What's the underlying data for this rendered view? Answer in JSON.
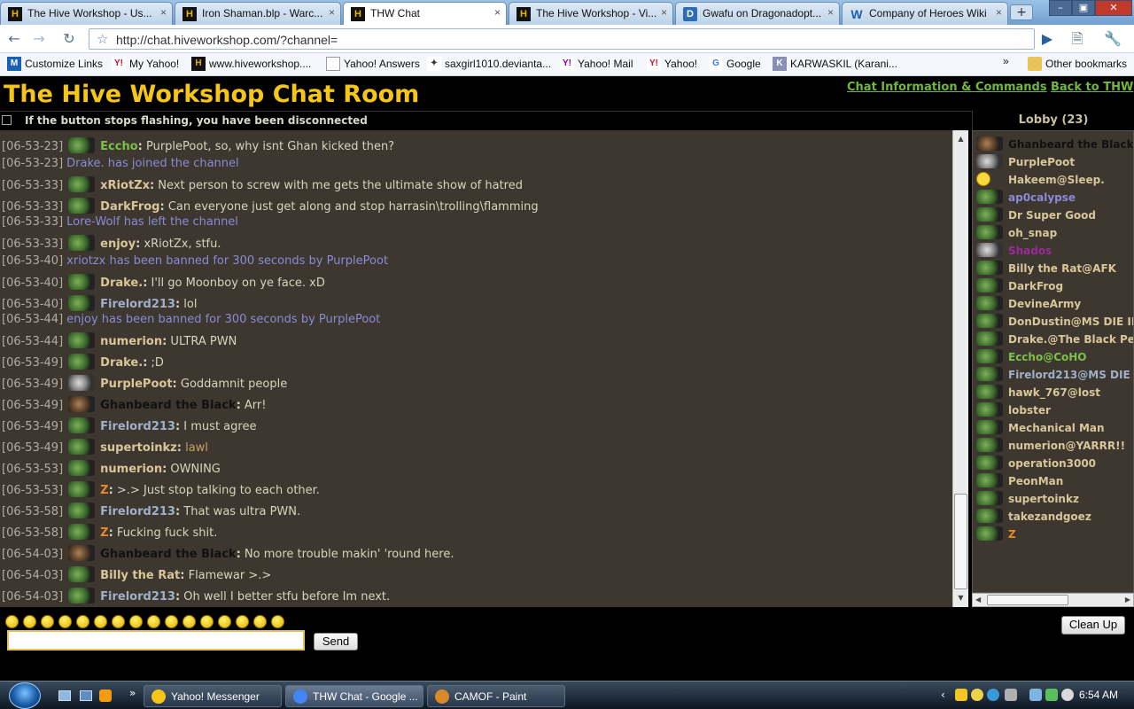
{
  "browser": {
    "tabs": [
      {
        "title": "The Hive Workshop - Us...",
        "icon": "hive",
        "active": false
      },
      {
        "title": "Iron Shaman.blp - Warc...",
        "icon": "hive",
        "active": false
      },
      {
        "title": "THW Chat",
        "icon": "hive",
        "active": true
      },
      {
        "title": "The Hive Workshop - Vi...",
        "icon": "hive",
        "active": false
      },
      {
        "title": "Gwafu on Dragonadopt...",
        "icon": "d",
        "active": false
      },
      {
        "title": "Company of Heroes Wiki",
        "icon": "w",
        "active": false
      }
    ],
    "url": "http://chat.hiveworkshop.com/?channel=",
    "bookmarks": [
      {
        "label": "Customize Links"
      },
      {
        "label": "My Yahoo!"
      },
      {
        "label": "www.hiveworkshop...."
      },
      {
        "label": "Yahoo! Answers"
      },
      {
        "label": "saxgirl1010.devianta..."
      },
      {
        "label": "Yahoo! Mail"
      },
      {
        "label": "Yahoo!"
      },
      {
        "label": "Google"
      },
      {
        "label": "KARWASKIL (Karani..."
      }
    ],
    "other_bookmarks": "Other bookmarks"
  },
  "page": {
    "title": "The Hive Workshop Chat Room",
    "link_info": "Chat Information & Commands",
    "link_back": "Back to THW",
    "notice": "If the button stops flashing, you have been disconnected",
    "lobby_title": "Lobby (23)",
    "send_label": "Send",
    "cleanup_label": "Clean Up",
    "colors": {
      "title": "#f5c518",
      "link": "#71b83c",
      "system": "#8a8ad6",
      "name_default": "#d8c69a"
    }
  },
  "messages": [
    {
      "time": "[06-53-23]",
      "user": "Eccho",
      "text": " PurplePoot, so, why isnt Ghan kicked then?",
      "avatar": "orc",
      "color": "#7cc04a"
    },
    {
      "time": "[06-53-23]",
      "system": "Drake. has joined the channel"
    },
    {
      "time": "[06-53-33]",
      "user": "xRiotZx",
      "text": " Next person to screw with me gets the ultimate show of hatred",
      "avatar": "orc",
      "color": "#d8c69a"
    },
    {
      "time": "[06-53-33]",
      "user": "DarkFrog",
      "text": " Can everyone just get along and stop harrasin\\trolling\\flamming",
      "avatar": "orc",
      "color": "#d8c69a"
    },
    {
      "time": "[06-53-33]",
      "system": "Lore-Wolf has left the channel"
    },
    {
      "time": "[06-53-33]",
      "user": "enjoy",
      "text": " xRiotZx, stfu.",
      "avatar": "orc",
      "color": "#d8c69a"
    },
    {
      "time": "[06-53-40]",
      "system": "xriotzx has been banned for 300 seconds by PurplePoot"
    },
    {
      "time": "[06-53-40]",
      "user": "Drake.",
      "text": " I'll go Moonboy on ye face. xD",
      "avatar": "orc",
      "color": "#d8c69a"
    },
    {
      "time": "[06-53-40]",
      "user": "Firelord213",
      "text": " lol",
      "avatar": "orc",
      "color": "#9fb0c8"
    },
    {
      "time": "[06-53-44]",
      "system": "enjoy has been banned for 300 seconds by PurplePoot"
    },
    {
      "time": "[06-53-44]",
      "user": "numerion",
      "text": " ULTRA PWN",
      "avatar": "orc",
      "color": "#d8c69a"
    },
    {
      "time": "[06-53-49]",
      "user": "Drake.",
      "text": " ;D",
      "avatar": "orc",
      "color": "#d8c69a"
    },
    {
      "time": "[06-53-49]",
      "user": "PurplePoot",
      "text": " Goddamnit people",
      "avatar": "pp",
      "color": "#d8c69a"
    },
    {
      "time": "[06-53-49]",
      "user": "Ghanbeard the Black",
      "text": " Arr!",
      "avatar": "gb",
      "color": "#111111"
    },
    {
      "time": "[06-53-49]",
      "user": "Firelord213",
      "text": " I must agree",
      "avatar": "orc",
      "color": "#9fb0c8"
    },
    {
      "time": "[06-53-49]",
      "user": "supertoinkz",
      "text": " lawl",
      "avatar": "orc",
      "color": "#d8c69a",
      "text_color": "#c8a060"
    },
    {
      "time": "[06-53-53]",
      "user": "numerion",
      "text": " OWNING",
      "avatar": "orc",
      "color": "#d8c69a"
    },
    {
      "time": "[06-53-53]",
      "user": "Z",
      "text": " >.> Just stop talking to each other.",
      "avatar": "orc",
      "color": "#e8882a"
    },
    {
      "time": "[06-53-58]",
      "user": "Firelord213",
      "text": " That was ultra PWN.",
      "avatar": "orc",
      "color": "#9fb0c8"
    },
    {
      "time": "[06-53-58]",
      "user": "Z",
      "text": " Fucking fuck shit.",
      "avatar": "orc",
      "color": "#e8882a"
    },
    {
      "time": "[06-54-03]",
      "user": "Ghanbeard the Black",
      "text": " No more trouble makin' 'round here.",
      "avatar": "gb",
      "color": "#111111"
    },
    {
      "time": "[06-54-03]",
      "user": "Billy the Rat",
      "text": " Flamewar >.>",
      "avatar": "orc",
      "color": "#d8c69a"
    },
    {
      "time": "[06-54-03]",
      "user": "Firelord213",
      "text": " Oh well I better stfu before Im next.",
      "avatar": "orc",
      "color": "#9fb0c8"
    }
  ],
  "lobby": [
    {
      "name": "Ghanbeard the Black",
      "avatar": "gb",
      "color": "#111111"
    },
    {
      "name": "PurplePoot",
      "avatar": "pp",
      "color": "#d8c69a"
    },
    {
      "name": "Hakeem@Sleep.",
      "avatar": "smiley",
      "color": "#d8c69a"
    },
    {
      "name": "ap0calypse",
      "avatar": "orc",
      "color": "#8a8ad6"
    },
    {
      "name": "Dr Super Good",
      "avatar": "orc",
      "color": "#d8c69a"
    },
    {
      "name": "oh_snap",
      "avatar": "orc",
      "color": "#d8c69a"
    },
    {
      "name": "Shados",
      "avatar": "pp",
      "color": "#9a2a9a"
    },
    {
      "name": "Billy the Rat@AFK",
      "avatar": "orc",
      "color": "#d8c69a"
    },
    {
      "name": "DarkFrog",
      "avatar": "orc",
      "color": "#d8c69a"
    },
    {
      "name": "DevineArmy",
      "avatar": "orc",
      "color": "#d8c69a"
    },
    {
      "name": "DonDustin@MS DIE IN",
      "avatar": "orc",
      "color": "#d8c69a"
    },
    {
      "name": "Drake.@The Black Pe",
      "avatar": "orc",
      "color": "#d8c69a"
    },
    {
      "name": "Eccho@CoHO",
      "avatar": "orc",
      "color": "#7cc04a"
    },
    {
      "name": "Firelord213@MS DIE",
      "avatar": "orc",
      "color": "#9fb0c8"
    },
    {
      "name": "hawk_767@lost",
      "avatar": "orc",
      "color": "#d8c69a"
    },
    {
      "name": "lobster",
      "avatar": "orc",
      "color": "#d8c69a"
    },
    {
      "name": "Mechanical Man",
      "avatar": "orc",
      "color": "#d8c69a"
    },
    {
      "name": "numerion@YARRR!!",
      "avatar": "orc",
      "color": "#d8c69a"
    },
    {
      "name": "operation3000",
      "avatar": "orc",
      "color": "#d8c69a"
    },
    {
      "name": "PeonMan",
      "avatar": "orc",
      "color": "#d8c69a"
    },
    {
      "name": "supertoinkz",
      "avatar": "orc",
      "color": "#d8c69a"
    },
    {
      "name": "takezandgoez",
      "avatar": "orc",
      "color": "#d8c69a"
    },
    {
      "name": "Z",
      "avatar": "orc",
      "color": "#e8882a"
    }
  ],
  "emoticons": [
    "smile",
    "wink",
    "cool",
    "grin",
    "laugh",
    "sad",
    "happy",
    "tongue",
    "blush",
    "frown",
    "exclaim",
    "question",
    "lol",
    "surprised",
    "confused",
    "eek"
  ],
  "taskbar": {
    "items": [
      {
        "label": "Yahoo! Messenger"
      },
      {
        "label": "THW Chat - Google ..."
      },
      {
        "label": "CAMOF - Paint"
      }
    ],
    "clock": "6:54 AM"
  }
}
